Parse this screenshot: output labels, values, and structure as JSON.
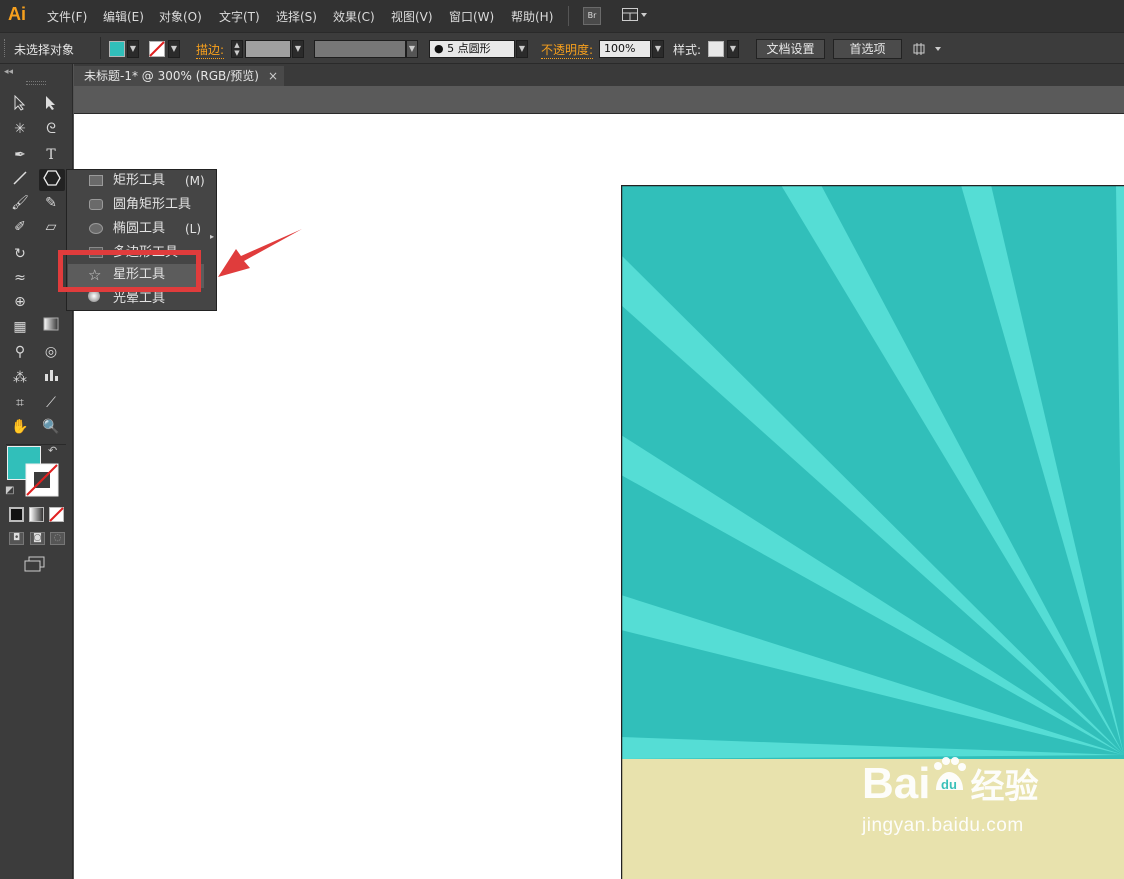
{
  "app": {
    "logo": "Ai"
  },
  "menubar": {
    "items": [
      "文件(F)",
      "编辑(E)",
      "对象(O)",
      "文字(T)",
      "选择(S)",
      "效果(C)",
      "视图(V)",
      "窗口(W)",
      "帮助(H)"
    ],
    "bridge_label": "Br"
  },
  "controlbar": {
    "selection_status": "未选择对象",
    "stroke_label": "描边:",
    "brush_value": "5 点圆形",
    "opacity_label": "不透明度:",
    "opacity_value": "100%",
    "style_label": "样式:",
    "doc_setup_button": "文档设置",
    "preferences_button": "首选项"
  },
  "document": {
    "tab_title": "未标题-1* @ 300% (RGB/预览)",
    "close_glyph": "×"
  },
  "flyout": {
    "items": [
      {
        "label": "矩形工具",
        "shortcut": "(M)",
        "icon": "rectangle-icon"
      },
      {
        "label": "圆角矩形工具",
        "shortcut": "",
        "icon": "rounded-rectangle-icon"
      },
      {
        "label": "椭圆工具",
        "shortcut": "(L)",
        "icon": "ellipse-icon"
      },
      {
        "label": "多边形工具",
        "shortcut": "",
        "icon": "polygon-icon"
      },
      {
        "label": "星形工具",
        "shortcut": "",
        "icon": "star-icon"
      },
      {
        "label": "光晕工具",
        "shortcut": "",
        "icon": "flare-icon"
      }
    ],
    "highlighted": "星形工具"
  },
  "colors": {
    "fill": "#31bfba",
    "ray": "#55ddd5",
    "ground": "#e8e2ad",
    "highlight": "#e03c3c",
    "accent": "#f7a01d"
  },
  "watermark": {
    "brand_prefix": "Bai",
    "brand_suffix": "经验",
    "url": "jingyan.baidu.com"
  }
}
